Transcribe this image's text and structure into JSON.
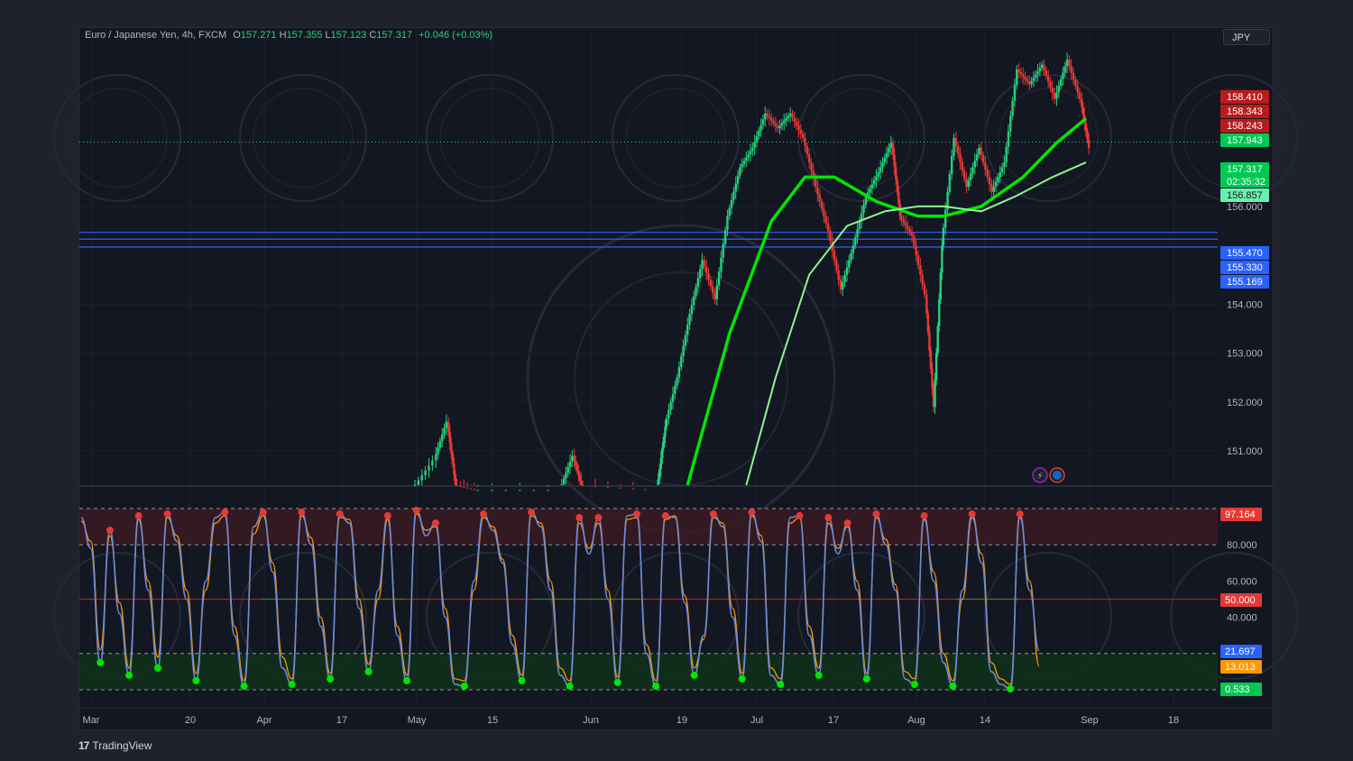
{
  "legend": {
    "symbol": "Euro / Japanese Yen, 4h, FXCM",
    "o_label": "O",
    "o": "157.271",
    "h_label": "H",
    "h": "157.355",
    "l_label": "L",
    "l": "157.123",
    "c_label": "C",
    "c": "157.317",
    "change": "+0.046 (+0.03%)"
  },
  "currency": "JPY",
  "brand": "TradingView",
  "colors": {
    "up": "#26d07c",
    "down": "#e53935",
    "bright_green": "#00e600",
    "blue_line": "#2962ff",
    "stoch_k": "#6e8bd6",
    "stoch_d": "#ff9800",
    "background": "#131722"
  },
  "chart_data": [
    {
      "type": "line",
      "title": "Euro / Japanese Yen, 4h, FXCM",
      "xlabel": "",
      "ylabel": "",
      "ylim": [
        150.3,
        159.3
      ],
      "x_ticks": [
        "Mar",
        "20",
        "Apr",
        "17",
        "May",
        "15",
        "Jun",
        "19",
        "Jul",
        "17",
        "Aug",
        "14",
        "Sep",
        "18"
      ],
      "y_ticks": [
        151.0,
        152.0,
        153.0,
        154.0,
        156.0
      ],
      "close_line": 157.317,
      "countdown": "02:35:32",
      "horizontal_levels": [
        155.47,
        155.33,
        155.169
      ],
      "price_tags": [
        {
          "value": 158.41,
          "label": "158.410",
          "color": "#b71c1c"
        },
        {
          "value": 158.343,
          "label": "158.343",
          "color": "#b71c1c"
        },
        {
          "value": 158.243,
          "label": "158.243",
          "color": "#b71c1c"
        },
        {
          "value": 157.943,
          "label": "157.943",
          "color": "#00c853"
        },
        {
          "value": 157.317,
          "label": "157.317",
          "color": "#00c853"
        },
        {
          "value": 156.857,
          "label": "156.857",
          "color": "#69f0ae"
        },
        {
          "value": 155.47,
          "label": "155.470",
          "color": "#2962ff"
        },
        {
          "value": 155.33,
          "label": "155.330",
          "color": "#2962ff"
        },
        {
          "value": 155.169,
          "label": "155.169",
          "color": "#2962ff"
        }
      ],
      "series": [
        {
          "values": [
            [
              8,
              150.2
            ],
            [
              8.5,
              150.8
            ],
            [
              8.8,
              151.6
            ],
            [
              9.0,
              150.3
            ],
            [
              9.5,
              150.2
            ],
            [
              11.5,
              150.2
            ],
            [
              11.8,
              150.9
            ],
            [
              12.0,
              150.3
            ],
            [
              13.8,
              150.2
            ],
            [
              14.0,
              151.5
            ],
            [
              14.3,
              152.5
            ],
            [
              14.6,
              153.8
            ],
            [
              14.9,
              154.9
            ],
            [
              15.2,
              154.1
            ],
            [
              15.5,
              155.8
            ],
            [
              15.8,
              156.8
            ],
            [
              16.1,
              157.2
            ],
            [
              16.4,
              157.9
            ],
            [
              16.7,
              157.6
            ],
            [
              17.0,
              157.9
            ],
            [
              17.3,
              157.4
            ],
            [
              17.6,
              156.4
            ],
            [
              17.9,
              155.5
            ],
            [
              18.2,
              154.3
            ],
            [
              18.5,
              155.2
            ],
            [
              18.8,
              156.2
            ],
            [
              19.1,
              156.7
            ],
            [
              19.4,
              157.3
            ],
            [
              19.6,
              155.8
            ],
            [
              19.9,
              155.4
            ],
            [
              20.2,
              154.2
            ],
            [
              20.4,
              151.9
            ],
            [
              20.6,
              155.2
            ],
            [
              20.9,
              157.4
            ],
            [
              21.2,
              156.4
            ],
            [
              21.5,
              157.2
            ],
            [
              21.8,
              156.3
            ],
            [
              22.1,
              156.9
            ],
            [
              22.4,
              158.8
            ],
            [
              22.7,
              158.5
            ],
            [
              23.0,
              158.9
            ],
            [
              23.3,
              158.2
            ],
            [
              23.6,
              159.0
            ],
            [
              23.9,
              158.2
            ],
            [
              24.1,
              157.2
            ]
          ]
        },
        {
          "values": [
            [
              14.5,
              150.2
            ],
            [
              15.5,
              153.4
            ],
            [
              16.5,
              155.7
            ],
            [
              17.3,
              156.6
            ],
            [
              18.0,
              156.6
            ],
            [
              19.0,
              156.1
            ],
            [
              20.0,
              155.8
            ],
            [
              20.6,
              155.8
            ],
            [
              21.5,
              156.0
            ],
            [
              22.5,
              156.6
            ],
            [
              23.3,
              157.3
            ],
            [
              24.0,
              157.8
            ]
          ]
        },
        {
          "values": [
            [
              15.9,
              150.2
            ],
            [
              16.6,
              152.5
            ],
            [
              17.4,
              154.6
            ],
            [
              18.3,
              155.6
            ],
            [
              19.2,
              155.9
            ],
            [
              20.0,
              156.0
            ],
            [
              20.6,
              156.0
            ],
            [
              21.5,
              155.9
            ],
            [
              22.3,
              156.2
            ],
            [
              23.2,
              156.6
            ],
            [
              24.0,
              156.9
            ]
          ]
        }
      ]
    },
    {
      "type": "line",
      "title": "",
      "ylim": [
        0,
        100
      ],
      "y_ticks": [
        40.0,
        60.0,
        80.0
      ],
      "bands": [
        20,
        50,
        80,
        100,
        0
      ],
      "value_tags": [
        {
          "value": 97.164,
          "label": "97.164",
          "color": "#e53935"
        },
        {
          "value": 50.0,
          "label": "50.000",
          "color": "#e53935"
        },
        {
          "value": 21.697,
          "label": "21.697",
          "color": "#2962ff"
        },
        {
          "value": 13.013,
          "label": "13.013",
          "color": "#ff9800"
        },
        {
          "value": 0.533,
          "label": "0.533",
          "color": "#00c853"
        }
      ],
      "series": [
        {
          "values": [
            95,
            78,
            15,
            88,
            42,
            8,
            96,
            55,
            12,
            97,
            82,
            50,
            5,
            60,
            95,
            98,
            30,
            2,
            90,
            98,
            65,
            12,
            3,
            98,
            80,
            35,
            6,
            97,
            92,
            45,
            10,
            55,
            96,
            30,
            5,
            99,
            85,
            92,
            40,
            3,
            2,
            60,
            97,
            88,
            70,
            25,
            5,
            98,
            90,
            55,
            8,
            2,
            95,
            75,
            95,
            50,
            4,
            96,
            97,
            20,
            2,
            96,
            95,
            48,
            8,
            30,
            97,
            90,
            40,
            6,
            98,
            82,
            8,
            3,
            95,
            96,
            30,
            8,
            95,
            75,
            92,
            55,
            6,
            97,
            80,
            55,
            6,
            3,
            96,
            60,
            15,
            2,
            55,
            97,
            70,
            10,
            3,
            0.5,
            97,
            55,
            21.7
          ]
        },
        {
          "values": [
            93,
            82,
            22,
            85,
            48,
            12,
            94,
            60,
            18,
            95,
            85,
            55,
            9,
            55,
            92,
            96,
            35,
            5,
            86,
            96,
            70,
            18,
            6,
            96,
            84,
            40,
            9,
            95,
            94,
            50,
            14,
            50,
            94,
            35,
            8,
            97,
            88,
            90,
            45,
            6,
            5,
            55,
            95,
            90,
            72,
            30,
            8,
            96,
            92,
            60,
            12,
            5,
            92,
            78,
            92,
            55,
            7,
            94,
            95,
            25,
            5,
            94,
            96,
            52,
            12,
            28,
            95,
            92,
            45,
            9,
            96,
            85,
            12,
            6,
            92,
            95,
            35,
            12,
            92,
            78,
            90,
            60,
            9,
            95,
            83,
            58,
            10,
            6,
            94,
            65,
            20,
            5,
            50,
            95,
            75,
            15,
            6,
            3,
            95,
            60,
            13.013
          ]
        }
      ]
    }
  ]
}
